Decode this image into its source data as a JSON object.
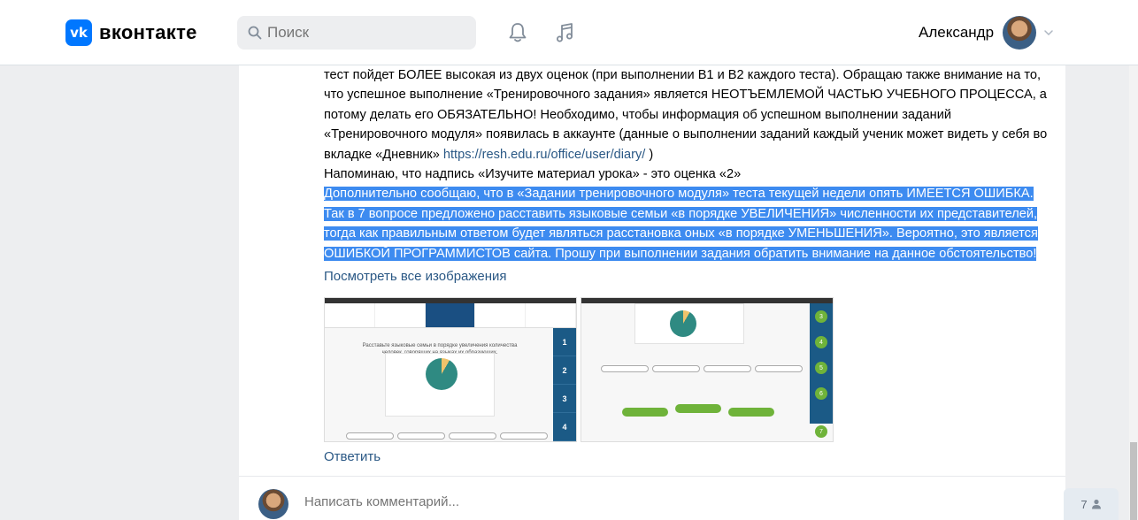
{
  "header": {
    "logo_badge": "vk",
    "logo_text": "вконтакте",
    "search_placeholder": "Поиск",
    "icons": [
      "bell-icon",
      "music-note-icon"
    ],
    "user_name": "Александр"
  },
  "post": {
    "paragraph1": "тест пойдет БОЛЕЕ высокая из двух оценок (при выполнении В1 и В2 каждого теста). Обращаю также внимание на то, что успешное выполнение «Тренировочного задания» является НЕОТЪЕМЛЕМОЙ ЧАСТЬЮ УЧЕБНОГО ПРОЦЕССА, а потому делать его ОБЯЗАТЕЛЬНО! Необходимо, чтобы информация об успешном выполнении заданий «Тренировочного модуля» появилась в аккаунте (данные о выполнении заданий каждый ученик может видеть у себя во вкладке «Дневник»",
    "link_text": "https://resh.edu.ru/office/user/diary/",
    "paragraph1_end": " )",
    "paragraph2": "Напоминаю, что надпись «Изучите материал урока» - это оценка «2»",
    "highlighted": "Дополнительно сообщаю, что в «Задании тренировочного модуля» теста текущей недели опять ИМЕЕТСЯ ОШИБКА. Так в 7 вопросе предложено расставить языковые семьи «в порядке УВЕЛИЧЕНИЯ» численности их представителей, тогда как правильным ответом будет являться расстановка оных «в порядке УМЕНЬШЕНИЯ». Вероятно, это является ОШИБКОЙ ПРОГРАММИСТОВ сайта. Прошу при выполнении задания обратить внимание на данное обстоятельство!",
    "show_all_images": "Посмотреть все изображения",
    "reply": "Ответить"
  },
  "image1": {
    "question": "Расставьте языковые семьи в порядке увеличения количества человек, говорящих на языках их образующих.",
    "side_numbers": [
      "1",
      "2",
      "3",
      "4"
    ]
  },
  "image2": {
    "side_numbers": [
      "3",
      "4",
      "5",
      "6",
      "7"
    ]
  },
  "comment": {
    "placeholder": "Написать комментарий..."
  },
  "viewers": {
    "count": "7"
  },
  "colors": {
    "accent": "#0077ff",
    "highlight": "#3d8bf0",
    "link": "#2a5885"
  }
}
